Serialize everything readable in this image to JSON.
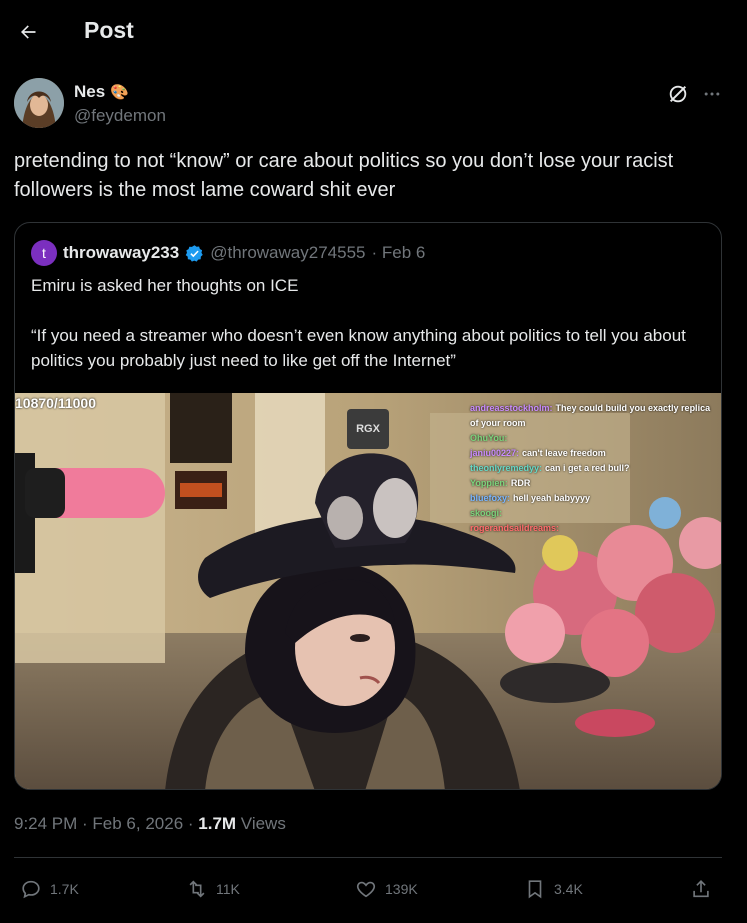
{
  "header": {
    "title": "Post"
  },
  "post": {
    "author_name": "Nes",
    "author_handle": "@feydemon",
    "author_emoji": "🎨",
    "text": "pretending to not “know” or care about politics so you don’t lose your racist followers is the most lame coward shit ever",
    "timestamp": "9:24 PM · Feb 6, 2026 · ",
    "views_count": "1.7M",
    "views_label": " Views"
  },
  "quote": {
    "avatar_letter": "t",
    "name": "throwaway233",
    "handle": "@throwaway274555",
    "date": "· Feb 6",
    "text_line1": "Emiru is asked her thoughts on ICE",
    "text_line2": "“If you need a streamer who doesn’t even know anything about politics to tell you about politics you probably just need to like get off the Internet”",
    "media": {
      "counter": "10870/11000",
      "logo": "RGX",
      "chat": [
        {
          "user": "andreasstockholm:",
          "msg": "They could build you exactly replica of your room"
        },
        {
          "user": "OhuYou:",
          "msg": ""
        },
        {
          "user": "janiu00227:",
          "msg": "can't leave freedom"
        },
        {
          "user": "theonlyremedyy:",
          "msg": "can i get a red bull?"
        },
        {
          "user": "Yoppien:",
          "msg": "RDR"
        },
        {
          "user": "bluefoxy:",
          "msg": "hell yeah babyyyy"
        },
        {
          "user": "skoogi:",
          "msg": ""
        },
        {
          "user": "rogerandsaildreams:",
          "msg": ""
        }
      ]
    }
  },
  "actions": {
    "replies": "1.7K",
    "reposts": "11K",
    "likes": "139K",
    "bookmarks": "3.4K"
  },
  "colors": {
    "bg": "#000000",
    "text": "#e7e9ea",
    "muted": "#71767b",
    "border": "#2f3336",
    "verified": "#1d9bf0"
  }
}
